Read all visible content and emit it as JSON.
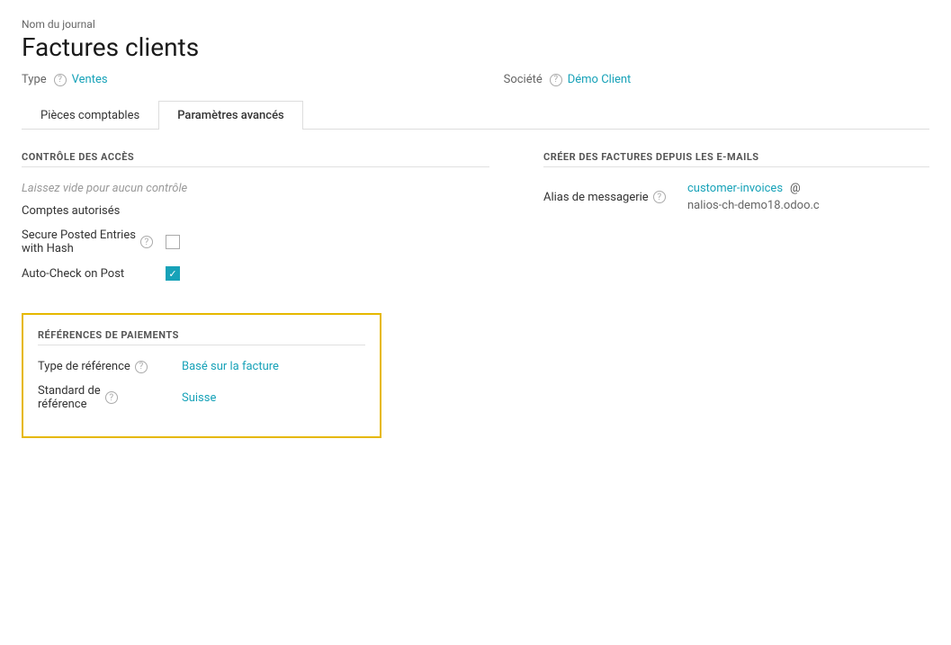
{
  "header": {
    "subtitle": "Nom du journal",
    "title": "Factures clients",
    "type_label": "Type",
    "type_help": "?",
    "type_value": "Ventes",
    "societe_label": "Société",
    "societe_help": "?",
    "societe_value": "Démo Client"
  },
  "tabs": [
    {
      "id": "pieces",
      "label": "Pièces comptables",
      "active": false
    },
    {
      "id": "params",
      "label": "Paramètres avancés",
      "active": true
    }
  ],
  "access_control": {
    "section_title": "CONTRÔLE DES ACCÈS",
    "empty_hint": "Laissez vide pour aucun contrôle",
    "comptes_label": "Comptes autorisés",
    "secure_label": "Secure Posted Entries",
    "secure_label2": "with Hash",
    "secure_help": "?",
    "secure_checked": false,
    "autocheck_label": "Auto-Check on Post",
    "autocheck_checked": true
  },
  "payment_refs": {
    "section_title": "RÉFÉRENCES DE PAIEMENTS",
    "type_ref_label": "Type de référence",
    "type_ref_help": "?",
    "type_ref_value": "Basé sur la facture",
    "standard_label": "Standard de",
    "standard_label2": "référence",
    "standard_help": "?",
    "standard_value": "Suisse"
  },
  "email_section": {
    "section_title": "CRÉER DES FACTURES DEPUIS LES E-MAILS",
    "alias_label": "Alias de messagerie",
    "alias_help": "?",
    "alias_value": "customer-invoices",
    "alias_at": "@",
    "alias_domain": "nalios-ch-demo18.odoo.c"
  },
  "icons": {
    "check": "✓"
  }
}
